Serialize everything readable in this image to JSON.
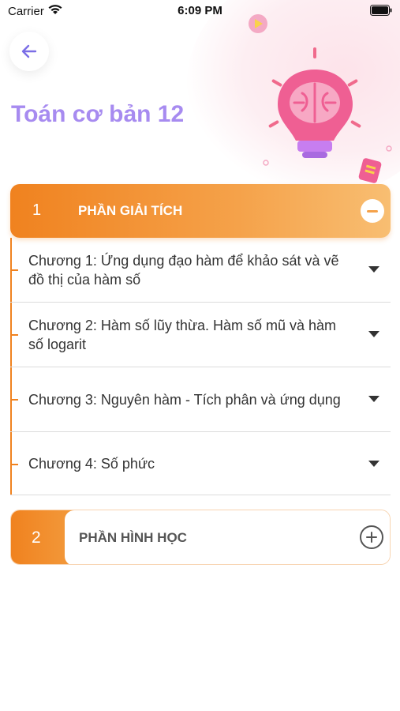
{
  "status_bar": {
    "carrier": "Carrier",
    "time": "6:09 PM"
  },
  "header": {
    "title": "Toán cơ bản 12"
  },
  "sections": [
    {
      "number": "1",
      "label": "PHẦN GIẢI TÍCH",
      "expanded": true,
      "chapters": [
        "Chương 1: Ứng dụng đạo hàm để khảo sát và vẽ đồ thị của hàm số",
        "Chương 2: Hàm số lũy thừa. Hàm số mũ và hàm số logarit",
        "Chương 3: Nguyên hàm - Tích phân và ứng dụng",
        "Chương 4: Số phức"
      ]
    },
    {
      "number": "2",
      "label": "PHẦN HÌNH HỌC",
      "expanded": false
    }
  ],
  "colors": {
    "accent": "#f0821f",
    "title": "#a78bf0",
    "back_arrow": "#7b6ee6"
  },
  "icons": [
    "back-arrow-icon",
    "wifi-icon",
    "battery-icon",
    "lightbulb-brain-icon",
    "collapse-icon",
    "expand-icon",
    "chevron-down-icon"
  ]
}
